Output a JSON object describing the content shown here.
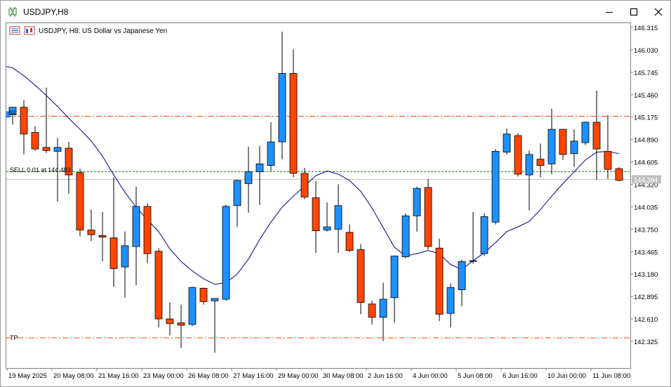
{
  "window": {
    "title": "USDJPY,H8",
    "controls": [
      "minimize",
      "maximize",
      "close"
    ]
  },
  "chart_header": {
    "text": "USDJPY, H8:  US Dollar vs Japanese Yen",
    "icons": [
      "one-click-trading-panel-icon",
      "chart-properties-icon"
    ]
  },
  "trade_labels": {
    "sl": "SL",
    "sell": "SELL 0.01 at 144.483",
    "tp": "TP"
  },
  "colors": {
    "bull": "#1e90ff",
    "bear": "#ff4500",
    "ma": "#00008b",
    "level_line": "#ff4500",
    "entry_line": "#008000",
    "bid_line": "#c0c0c0",
    "price_tag_bg": "#c0c0c0"
  },
  "chart_data": {
    "type": "candlestick",
    "symbol": "USDJPY",
    "timeframe": "H8",
    "ylim": [
      142.15,
      146.4
    ],
    "y_ticks": [
      "146.315",
      "146.030",
      "145.745",
      "145.460",
      "145.175",
      "144.890",
      "144.605",
      "144.320",
      "144.035",
      "143.750",
      "143.465",
      "143.180",
      "142.895",
      "142.610",
      "142.325"
    ],
    "x_ticks": [
      {
        "index": 0,
        "label": "19 May 2025"
      },
      {
        "index": 4,
        "label": "20 May 08:00"
      },
      {
        "index": 8,
        "label": "21 May 16:00"
      },
      {
        "index": 12,
        "label": "23 May 00:00"
      },
      {
        "index": 16,
        "label": "26 May 08:00"
      },
      {
        "index": 20,
        "label": "27 May 16:00"
      },
      {
        "index": 24,
        "label": "29 May 00:00"
      },
      {
        "index": 28,
        "label": "30 May 08:00"
      },
      {
        "index": 32,
        "label": "2 Jun 16:00"
      },
      {
        "index": 36,
        "label": "4 Jun 00:00"
      },
      {
        "index": 40,
        "label": "5 Jun 08:00"
      },
      {
        "index": 44,
        "label": "6 Jun 16:00"
      },
      {
        "index": 48,
        "label": "10 Jun 00:00"
      },
      {
        "index": 52,
        "label": "11 Jun 08:00"
      }
    ],
    "candles": [
      {
        "o": 145.21,
        "h": 145.3,
        "l": 145.08,
        "c": 145.3
      },
      {
        "o": 145.3,
        "h": 145.39,
        "l": 144.7,
        "c": 144.96
      },
      {
        "o": 144.98,
        "h": 145.06,
        "l": 144.75,
        "c": 144.77
      },
      {
        "o": 144.79,
        "h": 145.55,
        "l": 144.72,
        "c": 144.75
      },
      {
        "o": 144.74,
        "h": 144.91,
        "l": 144.1,
        "c": 144.79
      },
      {
        "o": 144.78,
        "h": 144.86,
        "l": 144.2,
        "c": 144.44
      },
      {
        "o": 144.47,
        "h": 144.52,
        "l": 143.66,
        "c": 143.74
      },
      {
        "o": 143.74,
        "h": 144.0,
        "l": 143.6,
        "c": 143.68
      },
      {
        "o": 143.67,
        "h": 143.97,
        "l": 143.34,
        "c": 143.65
      },
      {
        "o": 143.64,
        "h": 144.41,
        "l": 143.02,
        "c": 143.25
      },
      {
        "o": 143.27,
        "h": 143.72,
        "l": 142.88,
        "c": 143.54
      },
      {
        "o": 143.53,
        "h": 144.29,
        "l": 143.04,
        "c": 144.04
      },
      {
        "o": 144.04,
        "h": 144.08,
        "l": 143.32,
        "c": 143.44
      },
      {
        "o": 143.47,
        "h": 143.51,
        "l": 142.5,
        "c": 142.61
      },
      {
        "o": 142.61,
        "h": 142.82,
        "l": 142.4,
        "c": 142.55
      },
      {
        "o": 142.56,
        "h": 142.79,
        "l": 142.24,
        "c": 142.53
      },
      {
        "o": 142.54,
        "h": 143.02,
        "l": 142.52,
        "c": 143.01
      },
      {
        "o": 143.0,
        "h": 143.01,
        "l": 142.79,
        "c": 142.83
      },
      {
        "o": 142.84,
        "h": 142.87,
        "l": 142.18,
        "c": 142.87
      },
      {
        "o": 142.86,
        "h": 144.06,
        "l": 142.84,
        "c": 144.04
      },
      {
        "o": 144.05,
        "h": 144.38,
        "l": 143.78,
        "c": 144.37
      },
      {
        "o": 144.33,
        "h": 144.8,
        "l": 143.96,
        "c": 144.48
      },
      {
        "o": 144.48,
        "h": 144.81,
        "l": 144.06,
        "c": 144.58
      },
      {
        "o": 144.56,
        "h": 145.11,
        "l": 144.49,
        "c": 144.86
      },
      {
        "o": 144.86,
        "h": 146.26,
        "l": 144.64,
        "c": 145.73
      },
      {
        "o": 145.73,
        "h": 146.04,
        "l": 144.41,
        "c": 144.46
      },
      {
        "o": 144.46,
        "h": 144.53,
        "l": 144.13,
        "c": 144.16
      },
      {
        "o": 144.15,
        "h": 144.36,
        "l": 143.45,
        "c": 143.73
      },
      {
        "o": 143.74,
        "h": 144.09,
        "l": 143.72,
        "c": 143.78
      },
      {
        "o": 143.75,
        "h": 144.32,
        "l": 143.45,
        "c": 144.05
      },
      {
        "o": 143.71,
        "h": 143.81,
        "l": 143.46,
        "c": 143.48
      },
      {
        "o": 143.49,
        "h": 143.56,
        "l": 142.67,
        "c": 142.82
      },
      {
        "o": 142.8,
        "h": 142.84,
        "l": 142.54,
        "c": 142.63
      },
      {
        "o": 142.63,
        "h": 143.07,
        "l": 142.33,
        "c": 142.86
      },
      {
        "o": 142.88,
        "h": 143.41,
        "l": 142.56,
        "c": 143.41
      },
      {
        "o": 143.4,
        "h": 143.95,
        "l": 143.38,
        "c": 143.92
      },
      {
        "o": 143.92,
        "h": 144.29,
        "l": 143.72,
        "c": 144.27
      },
      {
        "o": 144.28,
        "h": 144.39,
        "l": 143.49,
        "c": 143.53
      },
      {
        "o": 143.51,
        "h": 143.63,
        "l": 142.58,
        "c": 142.67
      },
      {
        "o": 142.68,
        "h": 143.06,
        "l": 142.5,
        "c": 143.01
      },
      {
        "o": 142.98,
        "h": 143.36,
        "l": 142.77,
        "c": 143.34
      },
      {
        "o": 143.35,
        "h": 143.97,
        "l": 143.31,
        "c": 143.35
      },
      {
        "o": 143.44,
        "h": 143.95,
        "l": 143.41,
        "c": 143.91
      },
      {
        "o": 143.84,
        "h": 144.77,
        "l": 143.81,
        "c": 144.74
      },
      {
        "o": 144.73,
        "h": 145.03,
        "l": 144.7,
        "c": 144.96
      },
      {
        "o": 144.94,
        "h": 144.97,
        "l": 144.42,
        "c": 144.45
      },
      {
        "o": 144.44,
        "h": 144.75,
        "l": 143.99,
        "c": 144.7
      },
      {
        "o": 144.64,
        "h": 144.84,
        "l": 144.41,
        "c": 144.56
      },
      {
        "o": 144.58,
        "h": 145.28,
        "l": 144.45,
        "c": 145.02
      },
      {
        "o": 145.02,
        "h": 145.02,
        "l": 144.63,
        "c": 144.7
      },
      {
        "o": 144.71,
        "h": 145.02,
        "l": 144.54,
        "c": 144.87
      },
      {
        "o": 144.85,
        "h": 145.12,
        "l": 144.82,
        "c": 145.11
      },
      {
        "o": 145.11,
        "h": 145.51,
        "l": 144.38,
        "c": 144.77
      },
      {
        "o": 144.74,
        "h": 145.2,
        "l": 144.39,
        "c": 144.51
      },
      {
        "o": 144.52,
        "h": 144.54,
        "l": 144.36,
        "c": 144.37
      }
    ],
    "moving_average": [
      145.8,
      145.7,
      145.58,
      145.45,
      145.31,
      145.16,
      145.02,
      144.87,
      144.68,
      144.44,
      144.22,
      144.03,
      143.87,
      143.72,
      143.5,
      143.34,
      143.22,
      143.12,
      143.05,
      143.07,
      143.18,
      143.37,
      143.62,
      143.84,
      144.03,
      144.17,
      144.3,
      144.43,
      144.49,
      144.45,
      144.37,
      144.23,
      144.02,
      143.77,
      143.52,
      143.41,
      143.44,
      143.48,
      143.44,
      143.3,
      143.24,
      143.35,
      143.45,
      143.58,
      143.72,
      143.78,
      143.85,
      144.0,
      144.17,
      144.33,
      144.48,
      144.63,
      144.73,
      144.74,
      144.71
    ],
    "levels": {
      "sl": 145.186,
      "entry": 144.483,
      "tp": 142.37,
      "bid": 144.384
    },
    "price_tag": "144.384"
  }
}
